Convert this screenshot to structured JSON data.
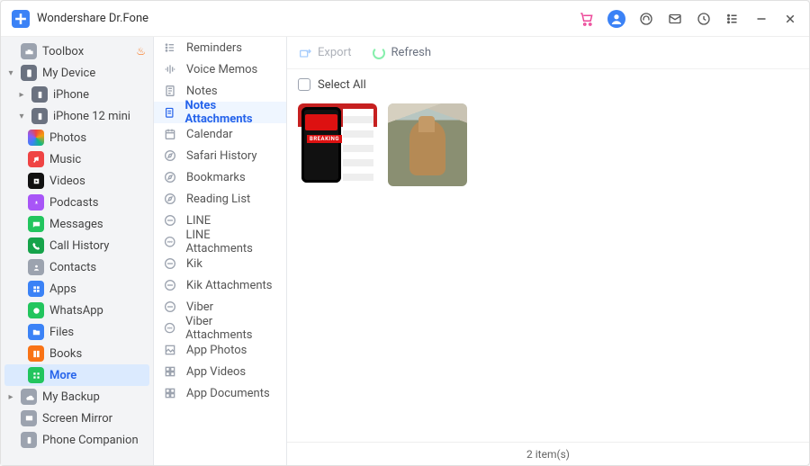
{
  "app": {
    "title": "Wondershare Dr.Fone"
  },
  "sidebar": {
    "toolbox": "Toolbox",
    "my_device": "My Device",
    "devices": [
      {
        "name": "iPhone"
      },
      {
        "name": "iPhone 12 mini"
      }
    ],
    "categories": {
      "photos": "Photos",
      "music": "Music",
      "videos": "Videos",
      "podcasts": "Podcasts",
      "messages": "Messages",
      "call_history": "Call History",
      "contacts": "Contacts",
      "apps": "Apps",
      "whatsapp": "WhatsApp",
      "files": "Files",
      "books": "Books",
      "more": "More"
    },
    "my_backup": "My Backup",
    "screen_mirror": "Screen Mirror",
    "phone_companion": "Phone Companion"
  },
  "midcol": {
    "items": [
      "Reminders",
      "Voice Memos",
      "Notes",
      "Notes Attachments",
      "Calendar",
      "Safari History",
      "Bookmarks",
      "Reading List",
      "LINE",
      "LINE Attachments",
      "Kik",
      "Kik Attachments",
      "Viber",
      "Viber Attachments",
      "App Photos",
      "App Videos",
      "App Documents"
    ],
    "active_index": 3
  },
  "toolbar": {
    "export": "Export",
    "refresh": "Refresh"
  },
  "selectall": "Select All",
  "thumb_breaking": "BREAKING",
  "status": "2  item(s)"
}
